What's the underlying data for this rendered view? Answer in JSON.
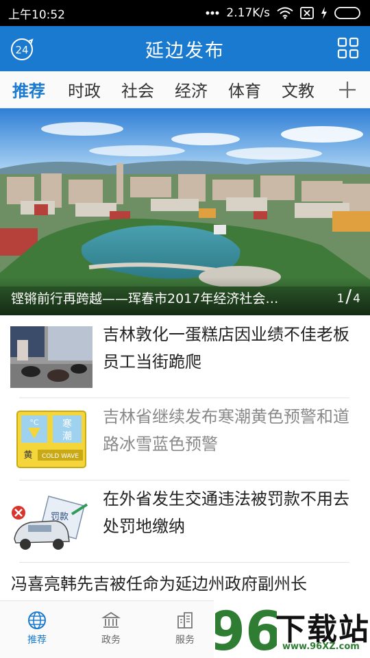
{
  "status_bar": {
    "time": "上午10:52",
    "network_speed": "2.17K/s",
    "icons": [
      "signal-dots-icon",
      "wifi-icon",
      "sim-icon",
      "charging-icon",
      "battery-icon"
    ]
  },
  "header": {
    "title": "延边发布",
    "left_icon_label": "24",
    "left_icon": "clock-24-icon",
    "right_icon": "grid-menu-icon",
    "background": "#1a7ad0"
  },
  "tabs": {
    "items": [
      "推荐",
      "时政",
      "社会",
      "经济",
      "体育",
      "文教"
    ],
    "active_index": 0,
    "add_icon": "plus-icon"
  },
  "hero": {
    "caption": "铿锵前行再跨越——珲春市2017年经济社会…",
    "page_current": "1",
    "page_total": "4"
  },
  "news": [
    {
      "title": "吉林敦化一蛋糕店因业绩不佳老板员工当街跪爬",
      "read": false
    },
    {
      "title": "吉林省继续发布寒潮黄色预警和道路冰雪蓝色预警",
      "read": true,
      "thumb_text": {
        "cold_symbol": "°C",
        "cold_vertical": "寒潮",
        "level": "黄",
        "english": "COLD WAVE"
      }
    },
    {
      "title": "在外省发生交通违法被罚款不用去处罚地缴纳",
      "read": false,
      "thumb_text": {
        "ticket": "罚款"
      }
    },
    {
      "title": "冯喜亮韩先吉被任命为延边州政府副州长",
      "read": false
    }
  ],
  "bottom_nav": {
    "items": [
      {
        "label": "推荐",
        "icon": "globe-icon",
        "active": true
      },
      {
        "label": "政务",
        "icon": "government-building-icon",
        "active": false
      },
      {
        "label": "服务",
        "icon": "city-building-icon",
        "active": false
      }
    ]
  },
  "watermark": {
    "number": "96",
    "text": "下载站",
    "url": "www.96XZ.com"
  },
  "colors": {
    "accent": "#1a7ad0",
    "read_text": "#888888",
    "watermark_green": "#2e7d32"
  }
}
